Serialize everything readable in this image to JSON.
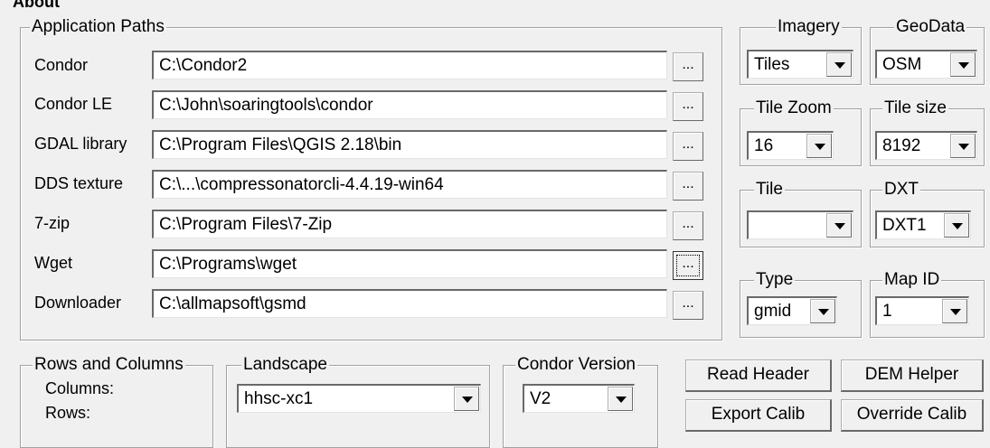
{
  "window": {
    "title_fragment": "About"
  },
  "app_paths": {
    "legend": "Application Paths",
    "rows": [
      {
        "label": "Condor",
        "value": "C:\\Condor2",
        "browse": "..."
      },
      {
        "label": "Condor LE",
        "value": "C:\\John\\soaringtools\\condor",
        "browse": "..."
      },
      {
        "label": "GDAL library",
        "value": "C:\\Program Files\\QGIS 2.18\\bin",
        "browse": "..."
      },
      {
        "label": "DDS texture",
        "value": "C:\\...\\compressonatorcli-4.4.19-win64",
        "browse": "..."
      },
      {
        "label": "7-zip",
        "value": "C:\\Program Files\\7-Zip",
        "browse": "..."
      },
      {
        "label": "Wget",
        "value": "C:\\Programs\\wget",
        "browse": "..."
      },
      {
        "label": "Downloader",
        "value": "C:\\allmapsoft\\gsmd",
        "browse": "..."
      }
    ]
  },
  "options": {
    "imagery": {
      "legend": "Imagery",
      "value": "Tiles"
    },
    "geodata": {
      "legend": "GeoData",
      "value": "OSM"
    },
    "tile_zoom": {
      "legend": "Tile Zoom",
      "value": "16"
    },
    "tile_size": {
      "legend": "Tile size",
      "value": "8192"
    },
    "tile": {
      "legend": "Tile",
      "value": ""
    },
    "dxt": {
      "legend": "DXT",
      "value": "DXT1"
    },
    "type": {
      "legend": "Type",
      "value": "gmid"
    },
    "map_id": {
      "legend": "Map ID",
      "value": "1"
    }
  },
  "rows_columns": {
    "legend": "Rows and Columns",
    "columns_label": "Columns:",
    "rows_label": "Rows:"
  },
  "landscape": {
    "legend": "Landscape",
    "value": "hhsc-xc1"
  },
  "condor_version": {
    "legend": "Condor Version",
    "value": "V2"
  },
  "buttons": {
    "read_header": "Read Header",
    "dem_helper": "DEM Helper",
    "export_calib": "Export Calib",
    "override_calib": "Override Calib"
  }
}
